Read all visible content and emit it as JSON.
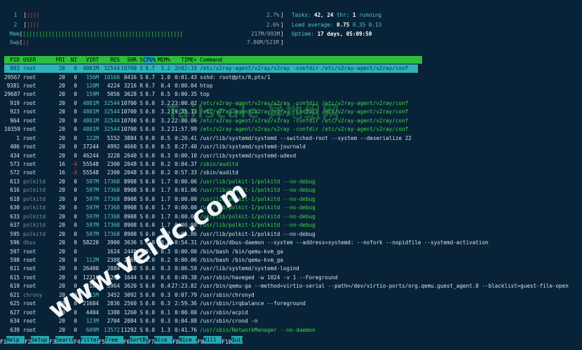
{
  "meters": {
    "cpu1": {
      "label": "1",
      "bars": "||||",
      "value": "2.7%"
    },
    "cpu2": {
      "label": "2",
      "bars": "||||",
      "value": "2.6%"
    },
    "mem": {
      "label": "Mem",
      "bars": "||||||||||||||||||||||||||||||||||||||||||||||||||",
      "value": "217M/993M"
    },
    "swp": {
      "label": "Swp",
      "bars": "||",
      "value": "7.80M/521M"
    }
  },
  "summary": {
    "tasks_label": "Tasks:",
    "tasks_value": "42,",
    "thr_value": "24",
    "thr_label": "thr;",
    "running_value": "1",
    "running_label": "running",
    "load_label": "Load average:",
    "load1": "0.75",
    "load5": "0.35",
    "load15": "0.13",
    "uptime_label": "Uptime:",
    "uptime_value": "17 days, 05:09:50"
  },
  "columns": [
    "PID",
    "USER",
    "PRI",
    "NI",
    "VIRT",
    "RES",
    "SHR",
    "S",
    "CPU%",
    "MEM%",
    "TIME+",
    "Command"
  ],
  "sorted_column": "CPU%",
  "selected_row": {
    "pid": "903",
    "user": "root",
    "pri": "20",
    "ni": "0",
    "virt": "4801M",
    "res": "32544",
    "shr": "10700",
    "s": "S",
    "cpu": "0.7",
    "mem": "3.2",
    "time": "2h02:19",
    "cmd": "/etc/v2ray-agent/v2ray/v2ray -confdir /etc/v2ray-agent/v2ray/conf"
  },
  "processes": [
    {
      "pid": "29567",
      "user": "root",
      "pri": "20",
      "ni": "0",
      "virt": "156M",
      "res": "10160",
      "shr": "8416",
      "s": "S",
      "cpu": "0.7",
      "mem": "1.0",
      "time": "0:01.43",
      "cmd": "sshd: root@pts/0,pts/1",
      "tone": "n"
    },
    {
      "pid": "9381",
      "user": "root",
      "pri": "20",
      "ni": "0",
      "virt": "120M",
      "res": "4224",
      "shr": "3216",
      "s": "R",
      "cpu": "0.7",
      "mem": "0.4",
      "time": "0:00.04",
      "cmd": "htop",
      "tone": "n"
    },
    {
      "pid": "29687",
      "user": "root",
      "pri": "20",
      "ni": "0",
      "virt": "159M",
      "res": "5056",
      "shr": "3628",
      "s": "S",
      "cpu": "0.7",
      "mem": "0.5",
      "time": "0:00.35",
      "cmd": "top",
      "tone": "n"
    },
    {
      "pid": "919",
      "user": "root",
      "pri": "20",
      "ni": "0",
      "virt": "4801M",
      "res": "32544",
      "shr": "10700",
      "s": "S",
      "cpu": "0.0",
      "mem": "3.2",
      "time": "23:00.02",
      "cmd": "/etc/v2ray-agent/v2ray/v2ray -confdir /etc/v2ray-agent/v2ray/conf",
      "tone": "g"
    },
    {
      "pid": "923",
      "user": "root",
      "pri": "20",
      "ni": "0",
      "virt": "4801M",
      "res": "32544",
      "shr": "10700",
      "s": "S",
      "cpu": "0.0",
      "mem": "3.2",
      "time": "19:35.13",
      "cmd": "/etc/v2ray-agent/v2ray/v2ray -confdir /etc/v2ray-agent/v2ray/conf",
      "tone": "g"
    },
    {
      "pid": "964",
      "user": "root",
      "pri": "20",
      "ni": "0",
      "virt": "4801M",
      "res": "32544",
      "shr": "10700",
      "s": "S",
      "cpu": "0.0",
      "mem": "3.2",
      "time": "22:00.06",
      "cmd": "/etc/v2ray-agent/v2ray/v2ray -confdir /etc/v2ray-agent/v2ray/conf",
      "tone": "g"
    },
    {
      "pid": "10359",
      "user": "root",
      "pri": "20",
      "ni": "0",
      "virt": "4801M",
      "res": "32544",
      "shr": "10700",
      "s": "S",
      "cpu": "0.0",
      "mem": "3.2",
      "time": "21:57.99",
      "cmd": "/etc/v2ray-agent/v2ray/v2ray -confdir /etc/v2ray-agent/v2ray/conf",
      "tone": "g"
    },
    {
      "pid": "1",
      "user": "root",
      "pri": "20",
      "ni": "0",
      "virt": "122M",
      "res": "5152",
      "shr": "3884",
      "s": "S",
      "cpu": "0.0",
      "mem": "0.5",
      "time": "0:20.41",
      "cmd": "/usr/lib/systemd/systemd --switched-root --system --deserialize 22",
      "tone": "n"
    },
    {
      "pid": "406",
      "user": "root",
      "pri": "20",
      "ni": "0",
      "virt": "37244",
      "res": "4992",
      "shr": "4660",
      "s": "S",
      "cpu": "0.0",
      "mem": "0.5",
      "time": "8:27.40",
      "cmd": "/usr/lib/systemd/systemd-journald",
      "tone": "n"
    },
    {
      "pid": "434",
      "user": "root",
      "pri": "20",
      "ni": "0",
      "virt": "46244",
      "res": "3228",
      "shr": "2640",
      "s": "S",
      "cpu": "0.0",
      "mem": "0.3",
      "time": "0:00.10",
      "cmd": "/usr/lib/systemd/systemd-udevd",
      "tone": "n"
    },
    {
      "pid": "573",
      "user": "root",
      "pri": "16",
      "ni": "-4",
      "virt": "55548",
      "res": "2300",
      "shr": "2048",
      "s": "S",
      "cpu": "0.0",
      "mem": "0.2",
      "time": "0:04.37",
      "cmd": "/sbin/auditd",
      "tone": "g"
    },
    {
      "pid": "572",
      "user": "root",
      "pri": "16",
      "ni": "-4",
      "virt": "55548",
      "res": "2300",
      "shr": "2048",
      "s": "S",
      "cpu": "0.0",
      "mem": "0.2",
      "time": "0:57.33",
      "cmd": "/sbin/auditd",
      "tone": "n"
    },
    {
      "pid": "613",
      "user": "polkitd",
      "pri": "20",
      "ni": "0",
      "virt": "597M",
      "res": "17368",
      "shr": "8908",
      "s": "S",
      "cpu": "0.0",
      "mem": "1.7",
      "time": "0:00.06",
      "cmd": "/usr/lib/polkit-1/polkitd --no-debug",
      "tone": "g"
    },
    {
      "pid": "616",
      "user": "polkitd",
      "pri": "20",
      "ni": "0",
      "virt": "597M",
      "res": "17368",
      "shr": "8908",
      "s": "S",
      "cpu": "0.0",
      "mem": "1.7",
      "time": "0:01.06",
      "cmd": "/usr/lib/polkit-1/polkitd --no-debug",
      "tone": "g"
    },
    {
      "pid": "618",
      "user": "polkitd",
      "pri": "20",
      "ni": "0",
      "virt": "597M",
      "res": "17368",
      "shr": "8908",
      "s": "S",
      "cpu": "0.0",
      "mem": "1.7",
      "time": "0:00.00",
      "cmd": "/usr/lib/polkit-1/polkitd --no-debug",
      "tone": "g"
    },
    {
      "pid": "630",
      "user": "polkitd",
      "pri": "20",
      "ni": "0",
      "virt": "597M",
      "res": "17368",
      "shr": "8908",
      "s": "S",
      "cpu": "0.0",
      "mem": "1.7",
      "time": "0:00.00",
      "cmd": "/usr/lib/polkit-1/polkitd --no-debug",
      "tone": "g"
    },
    {
      "pid": "633",
      "user": "polkitd",
      "pri": "20",
      "ni": "0",
      "virt": "597M",
      "res": "17368",
      "shr": "8908",
      "s": "S",
      "cpu": "0.0",
      "mem": "1.7",
      "time": "0:00.00",
      "cmd": "/usr/lib/polkit-1/polkitd --no-debug",
      "tone": "g"
    },
    {
      "pid": "637",
      "user": "polkitd",
      "pri": "20",
      "ni": "0",
      "virt": "597M",
      "res": "17368",
      "shr": "8908",
      "s": "S",
      "cpu": "0.0",
      "mem": "1.7",
      "time": "0:00.00",
      "cmd": "/usr/lib/polkit-1/polkitd --no-debug",
      "tone": "g"
    },
    {
      "pid": "595",
      "user": "polkitd",
      "pri": "20",
      "ni": "0",
      "virt": "597M",
      "res": "17368",
      "shr": "8908",
      "s": "S",
      "cpu": "0.0",
      "mem": "1.7",
      "time": "0:01.86",
      "cmd": "/usr/lib/polkit-1/polkitd --no-debug",
      "tone": "n"
    },
    {
      "pid": "596",
      "user": "dbus",
      "pri": "20",
      "ni": "0",
      "virt": "58220",
      "res": "3900",
      "shr": "3636",
      "s": "S",
      "cpu": "0.0",
      "mem": "0.4",
      "time": "0:54.31",
      "cmd": "/usr/bin/dbus-daemon --system --address=systemd: --nofork --nopidfile --systemd-activation",
      "tone": "n"
    },
    {
      "pid": "597",
      "user": "root",
      "pri": "20",
      "ni": "0",
      "virt": "",
      "res": "1624",
      "shr": "2440",
      "s": "S",
      "cpu": "0.0",
      "mem": "0.3",
      "time": "0:00.00",
      "cmd": "/bin/bash /bin/qemu-kvm_ga",
      "tone": "n"
    },
    {
      "pid": "598",
      "user": "root",
      "pri": "20",
      "ni": "0",
      "virt": "112M",
      "res": "2388",
      "shr": "2160",
      "s": "S",
      "cpu": "0.0",
      "mem": "0.2",
      "time": "0:00.06",
      "cmd": "/bin/bash /bin/qemu-kvm_ga",
      "tone": "n"
    },
    {
      "pid": "611",
      "user": "root",
      "pri": "20",
      "ni": "0",
      "virt": "26400",
      "res": "2884",
      "shr": "2588",
      "s": "S",
      "cpu": "0.0",
      "mem": "0.3",
      "time": "0:06.59",
      "cmd": "/usr/lib/systemd/systemd-logind",
      "tone": "n"
    },
    {
      "pid": "615",
      "user": "root",
      "pri": "20",
      "ni": "0",
      "virt": "12216",
      "res": "6264",
      "shr": "1644",
      "s": "S",
      "cpu": "0.0",
      "mem": "0.6",
      "time": "0:49.38",
      "cmd": "/usr/sbin/haveged -w 1024 -v 1 --Foreground",
      "tone": "n"
    },
    {
      "pid": "619",
      "user": "root",
      "pri": "20",
      "ni": "0",
      "virt": "44184",
      "res": "3964",
      "shr": "3620",
      "s": "S",
      "cpu": "0.0",
      "mem": "0.4",
      "time": "27:23.82",
      "cmd": "/usr/bin/qemu-ga --method=virtio-serial --path=/dev/virtio-ports/org.qemu.guest_agent.0 --blacklist=guest-file-open",
      "tone": "n"
    },
    {
      "pid": "621",
      "user": "chrony",
      "pri": "20",
      "ni": "0",
      "virt": "115M",
      "res": "3452",
      "shr": "3092",
      "s": "S",
      "cpu": "0.0",
      "mem": "0.3",
      "time": "0:07.79",
      "cmd": "/usr/sbin/chronyd",
      "tone": "n"
    },
    {
      "pid": "625",
      "user": "root",
      "pri": "20",
      "ni": "0",
      "virt": "21684",
      "res": "2836",
      "shr": "2560",
      "s": "S",
      "cpu": "0.0",
      "mem": "0.3",
      "time": "2:59.36",
      "cmd": "/usr/sbin/irqbalance --foreground",
      "tone": "n"
    },
    {
      "pid": "627",
      "user": "root",
      "pri": "20",
      "ni": "0",
      "virt": "4404",
      "res": "1380",
      "shr": "1260",
      "s": "S",
      "cpu": "0.0",
      "mem": "0.1",
      "time": "0:00.00",
      "cmd": "/usr/sbin/acpid",
      "tone": "n"
    },
    {
      "pid": "634",
      "user": "root",
      "pri": "20",
      "ni": "0",
      "virt": "123M",
      "res": "2704",
      "shr": "2084",
      "s": "S",
      "cpu": "0.0",
      "mem": "0.3",
      "time": "0:04.88",
      "cmd": "/usr/sbin/crond -n",
      "tone": "n"
    },
    {
      "pid": "639",
      "user": "root",
      "pri": "20",
      "ni": "0",
      "virt": "609M",
      "res": "13572",
      "shr": "11292",
      "s": "S",
      "cpu": "0.0",
      "mem": "1.3",
      "time": "0:41.76",
      "cmd": "/usr/sbin/NetworkManager --no-daemon",
      "tone": "g"
    }
  ],
  "fkeys": [
    {
      "key": "F1",
      "label": "Help"
    },
    {
      "key": "F2",
      "label": "Setup"
    },
    {
      "key": "F3",
      "label": "Search"
    },
    {
      "key": "F4",
      "label": "Filter"
    },
    {
      "key": "F5",
      "label": "Tree"
    },
    {
      "key": "F6",
      "label": "SortBy"
    },
    {
      "key": "F7",
      "label": "Nice -"
    },
    {
      "key": "F8",
      "label": "Nice +"
    },
    {
      "key": "F9",
      "label": "Kill"
    },
    {
      "key": "F10",
      "label": "Quit"
    }
  ],
  "watermark": "www.veidc.com",
  "watermark_faint": "Tailscale 异地组网"
}
